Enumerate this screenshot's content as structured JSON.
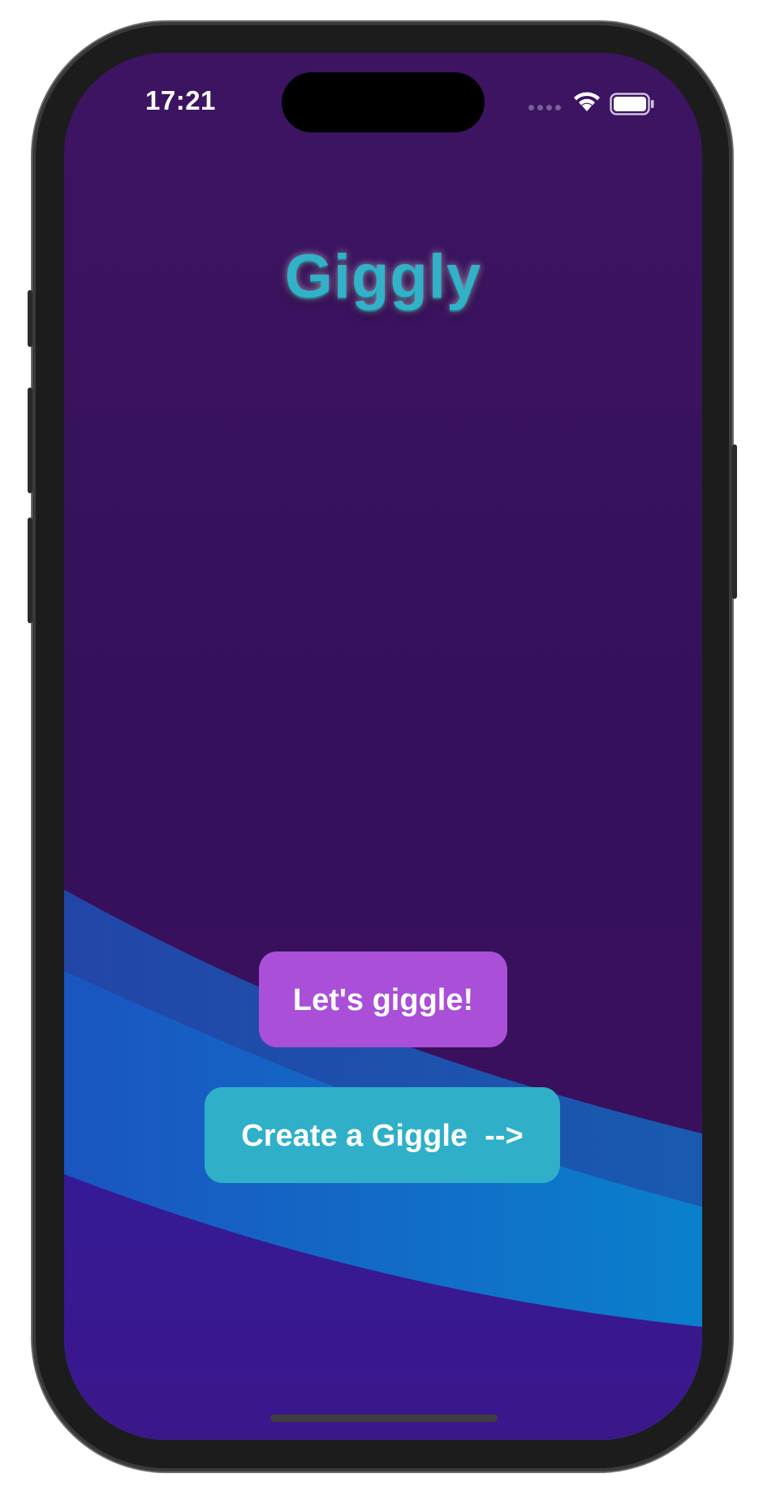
{
  "status_bar": {
    "time": "17:21",
    "icons": [
      "cellular-signal-icon",
      "wifi-icon",
      "battery-icon"
    ]
  },
  "app": {
    "title": "Giggly"
  },
  "buttons": {
    "giggle_label": "Let's giggle!",
    "create_label": "Create a Giggle  -->"
  },
  "colors": {
    "background": "#3a115f",
    "title": "#32b1c8",
    "giggle_button": "#a94fd8",
    "create_button": "#2fb0c8",
    "wave_dark_blue": "#1f4fb0",
    "wave_blue": "#1676cc",
    "wave_bottom": "#3a1a90"
  }
}
